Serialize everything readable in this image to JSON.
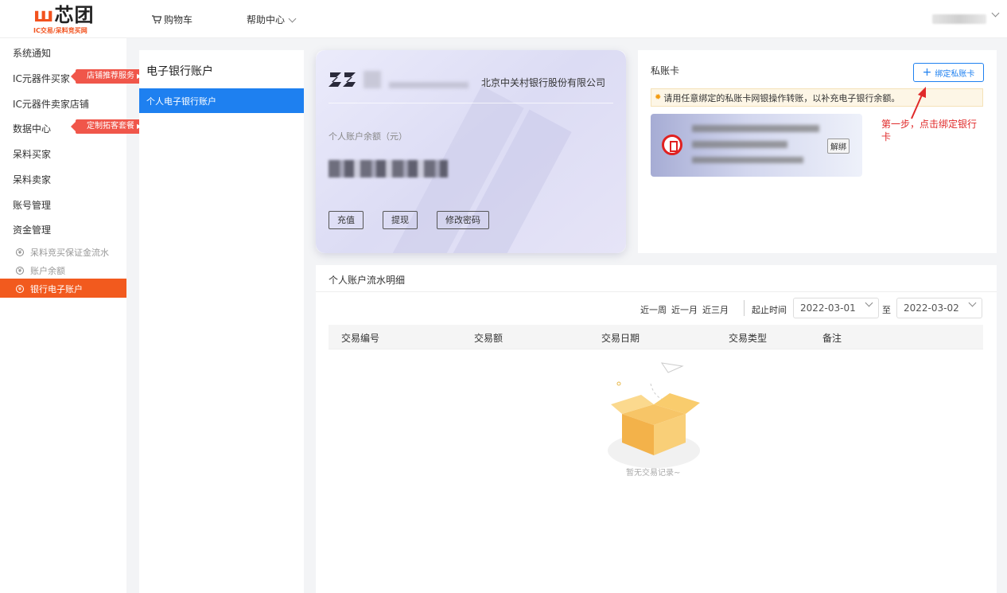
{
  "header": {
    "logo_text": "芯团",
    "logo_sub": "IC交易/呆料竞买网",
    "cart": "购物车",
    "help": "帮助中心"
  },
  "leftnav": {
    "items": [
      {
        "label": "系统通知"
      },
      {
        "label": "IC元器件买家",
        "tag": "店铺推荐服务"
      },
      {
        "label": "IC元器件卖家店铺"
      },
      {
        "label": "数据中心",
        "tag": "定制拓客套餐"
      },
      {
        "label": "呆料买家"
      },
      {
        "label": "呆料卖家"
      },
      {
        "label": "账号管理"
      },
      {
        "label": "资金管理"
      }
    ],
    "sub_items": [
      {
        "label": "呆料竞买保证金流水",
        "icon": "coin-icon"
      },
      {
        "label": "账户余额",
        "icon": "wallet-icon"
      },
      {
        "label": "银行电子账户",
        "icon": "bank-icon",
        "active": true
      }
    ]
  },
  "midpanel": {
    "title": "电子银行账户",
    "active_item": "个人电子银行账户"
  },
  "bankcard": {
    "bank_name": "北京中关村银行股份有限公司",
    "balance_label": "个人账户余额（元）",
    "buttons": [
      "充值",
      "提现",
      "修改密码"
    ]
  },
  "private_card": {
    "title": "私账卡",
    "bind_button": "绑定私账卡",
    "notice": "请用任意绑定的私账卡网银操作转账，以补充电子银行余额。",
    "unbind": "解绑",
    "step_note": "第一步，点击绑定银行卡"
  },
  "transactions": {
    "title": "个人账户流水明细",
    "quick_ranges": [
      "近一周",
      "近一月",
      "近三月"
    ],
    "range_label": "起止时间",
    "start_date": "2022-03-01",
    "to_label": "至",
    "end_date": "2022-03-02",
    "columns": [
      "交易编号",
      "交易额",
      "交易日期",
      "交易类型",
      "备注"
    ],
    "empty_text": "暂无交易记录~"
  },
  "colors": {
    "accent_orange": "#f25a1e",
    "accent_blue": "#1e80f0",
    "annotation_red": "#e02a2a"
  }
}
